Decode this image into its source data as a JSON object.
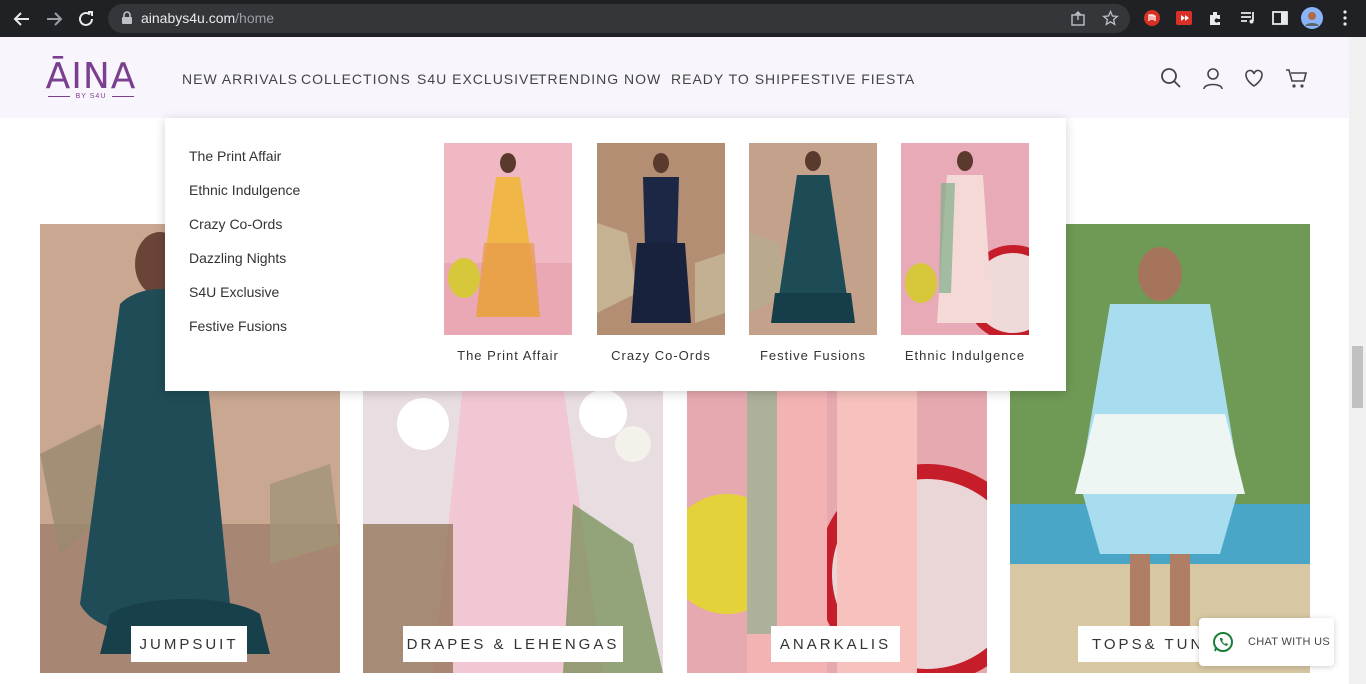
{
  "browser": {
    "url_domain": "ainabys4u.com",
    "url_path": "/home"
  },
  "brand": {
    "name": "ĀINA",
    "sub": "BY S4U"
  },
  "nav": {
    "items": [
      {
        "label": "NEW ARRIVALS"
      },
      {
        "label": "COLLECTIONS"
      },
      {
        "label": "S4U EXCLUSIVE"
      },
      {
        "label": "TRENDING NOW"
      },
      {
        "label": "READY TO SHIP"
      },
      {
        "label": "FESTIVE FIESTA"
      }
    ]
  },
  "dropdown": {
    "links": [
      {
        "label": "The Print Affair"
      },
      {
        "label": "Ethnic Indulgence"
      },
      {
        "label": "Crazy Co-Ords"
      },
      {
        "label": "Dazzling Nights"
      },
      {
        "label": "S4U Exclusive"
      },
      {
        "label": "Festive Fusions"
      }
    ],
    "cards": [
      {
        "caption": "The Print Affair"
      },
      {
        "caption": "Crazy Co-Ords"
      },
      {
        "caption": "Festive Fusions"
      },
      {
        "caption": "Ethnic Indulgence"
      }
    ]
  },
  "categories": [
    {
      "label": "JUMPSUIT"
    },
    {
      "label": "DRAPES & LEHENGAS"
    },
    {
      "label": "ANARKALIS"
    },
    {
      "label": "TOPS& TUNICS"
    }
  ],
  "chat": {
    "label": "CHAT WITH US"
  },
  "colors": {
    "brand": "#7b3f8f",
    "header_bg": "#f8f6fc",
    "whatsapp": "#25d366"
  }
}
